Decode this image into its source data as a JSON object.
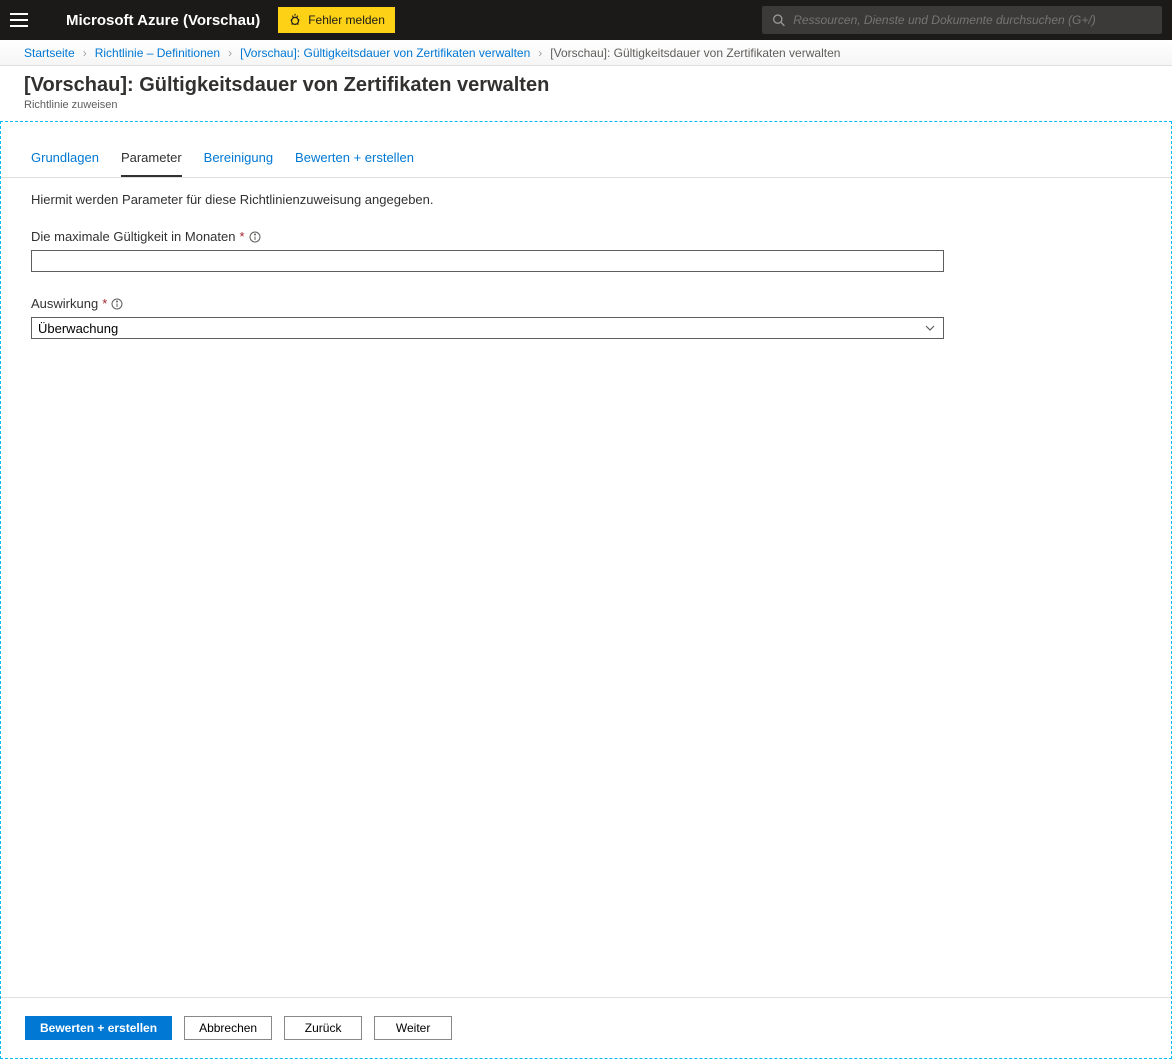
{
  "header": {
    "brand": "Microsoft Azure (Vorschau)",
    "report_label": "Fehler melden",
    "search_placeholder": "Ressourcen, Dienste und Dokumente durchsuchen (G+/)"
  },
  "breadcrumb": {
    "items": [
      {
        "label": "Startseite"
      },
      {
        "label": "Richtlinie – Definitionen"
      },
      {
        "label": "[Vorschau]: Gültigkeitsdauer von Zertifikaten verwalten"
      }
    ],
    "current": "[Vorschau]: Gültigkeitsdauer von Zertifikaten verwalten"
  },
  "page": {
    "title": "[Vorschau]: Gültigkeitsdauer von Zertifikaten verwalten",
    "subtitle": "Richtlinie zuweisen"
  },
  "tabs": {
    "grundlagen": "Grundlagen",
    "parameter": "Parameter",
    "bereinigung": "Bereinigung",
    "bewerten": "Bewerten + erstellen"
  },
  "form": {
    "intro": "Hiermit werden Parameter für diese Richtlinienzuweisung angegeben.",
    "max_validity_label": "Die maximale Gültigkeit in Monaten",
    "max_validity_value": "",
    "effect_label": "Auswirkung",
    "effect_value": "Überwachung"
  },
  "footer": {
    "review_create": "Bewerten + erstellen",
    "cancel": "Abbrechen",
    "back": "Zurück",
    "next": "Weiter"
  }
}
